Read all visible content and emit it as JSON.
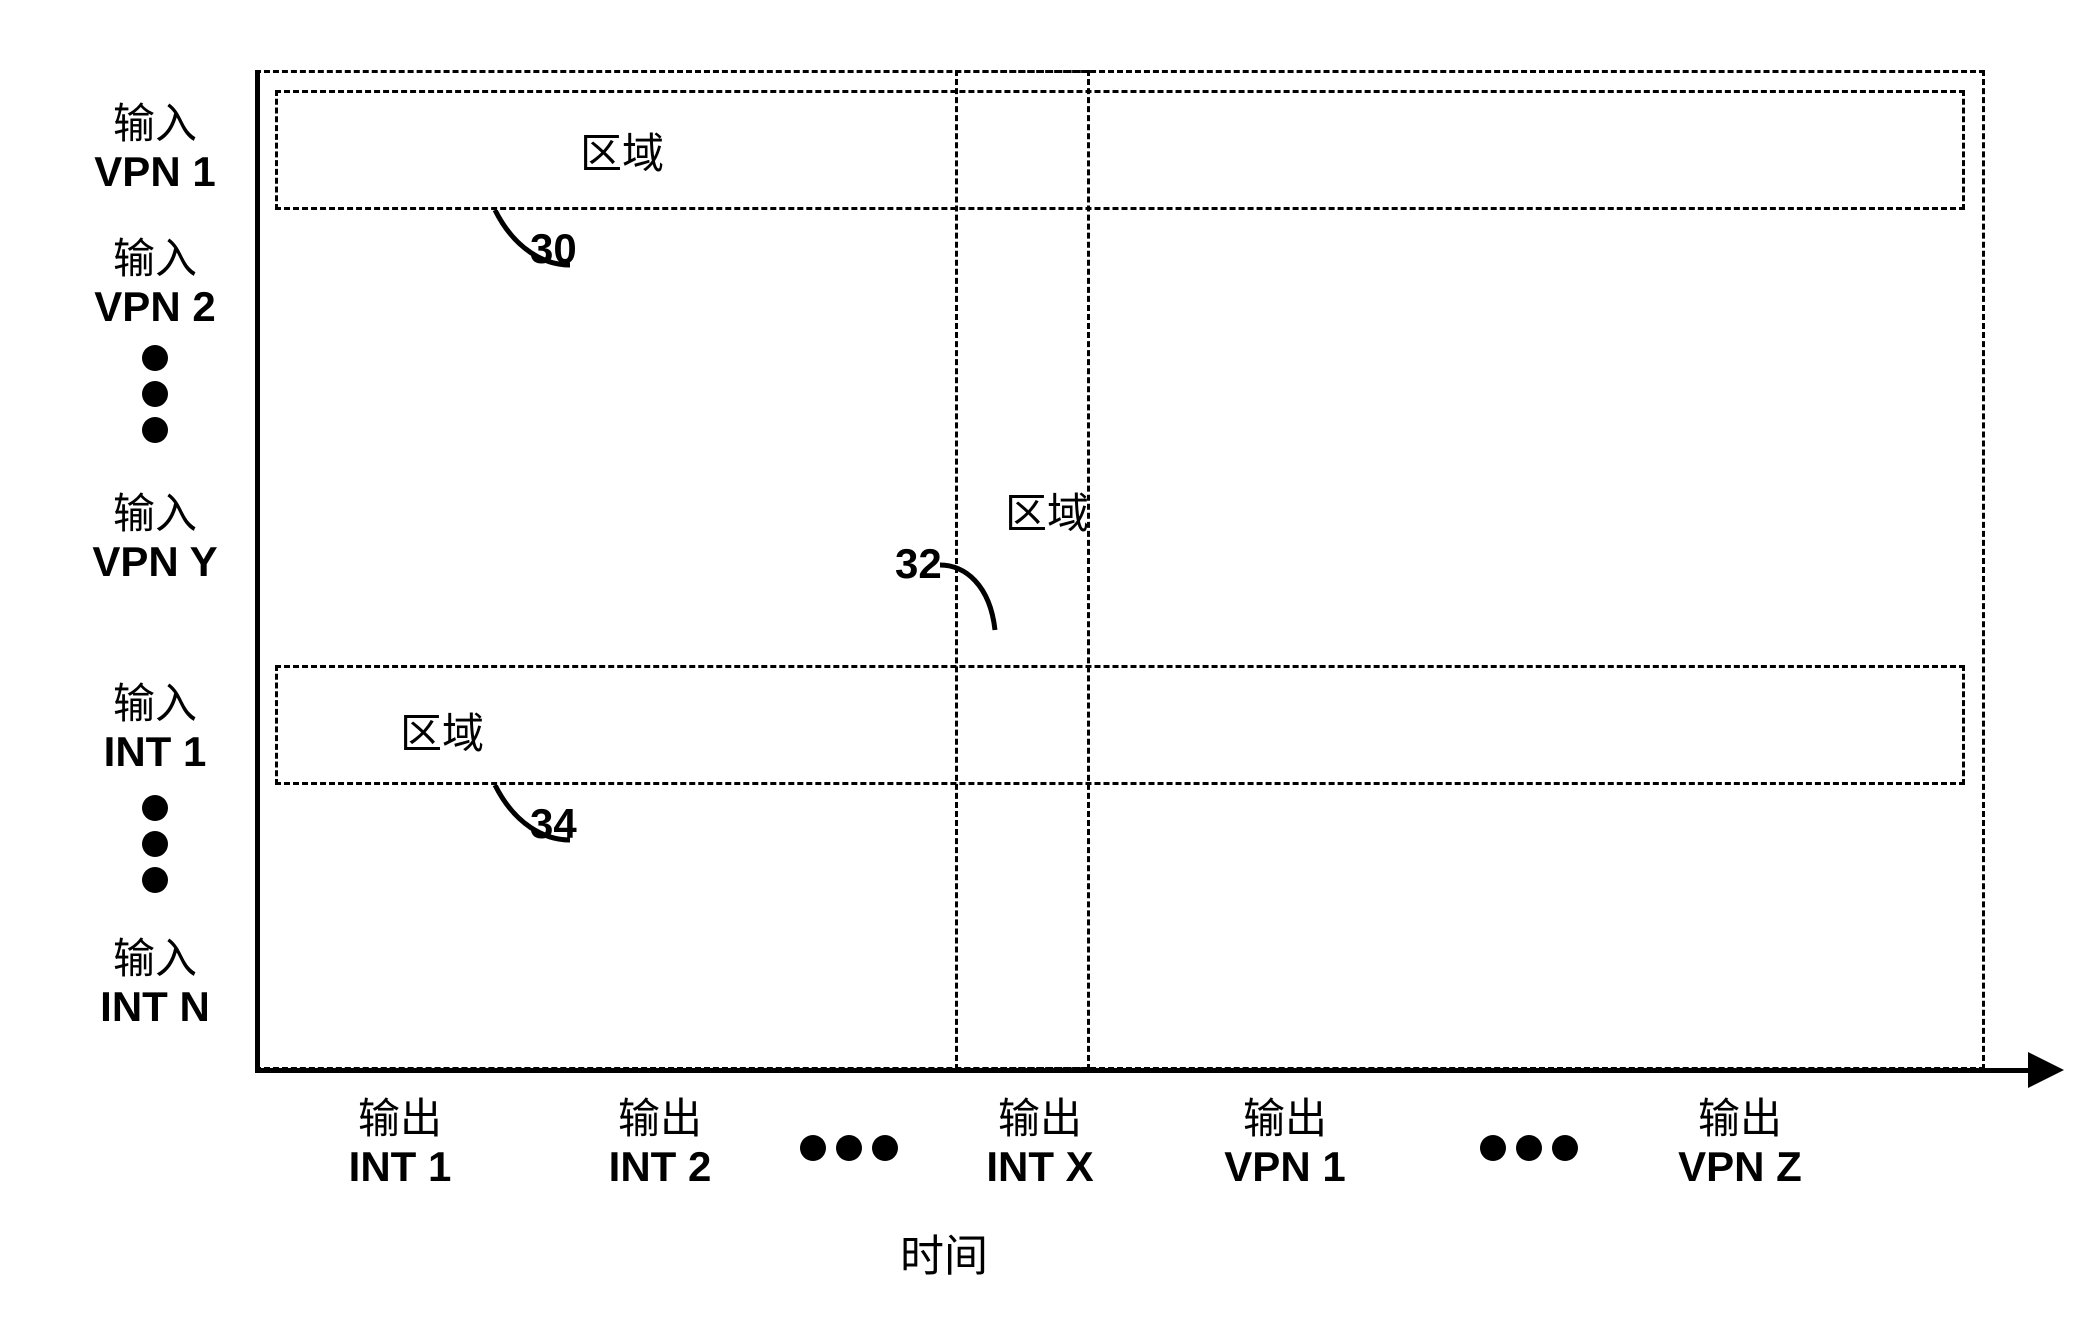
{
  "y_axis": {
    "items": [
      {
        "cn": "输入",
        "code": "VPN 1"
      },
      {
        "cn": "输入",
        "code": "VPN 2"
      },
      {
        "cn": "输入",
        "code": "VPN Y"
      },
      {
        "cn": "输入",
        "code": "INT 1"
      },
      {
        "cn": "输入",
        "code": "INT N"
      }
    ]
  },
  "x_axis": {
    "title": "时间",
    "items": [
      {
        "cn": "输出",
        "code": "INT 1"
      },
      {
        "cn": "输出",
        "code": "INT 2"
      },
      {
        "cn": "输出",
        "code": "INT X"
      },
      {
        "cn": "输出",
        "code": "VPN 1"
      },
      {
        "cn": "输出",
        "code": "VPN Z"
      }
    ]
  },
  "regions": {
    "r30": {
      "label": "区域",
      "num": "30"
    },
    "r32": {
      "label": "区域",
      "num": "32"
    },
    "r34": {
      "label": "区域",
      "num": "34"
    }
  }
}
